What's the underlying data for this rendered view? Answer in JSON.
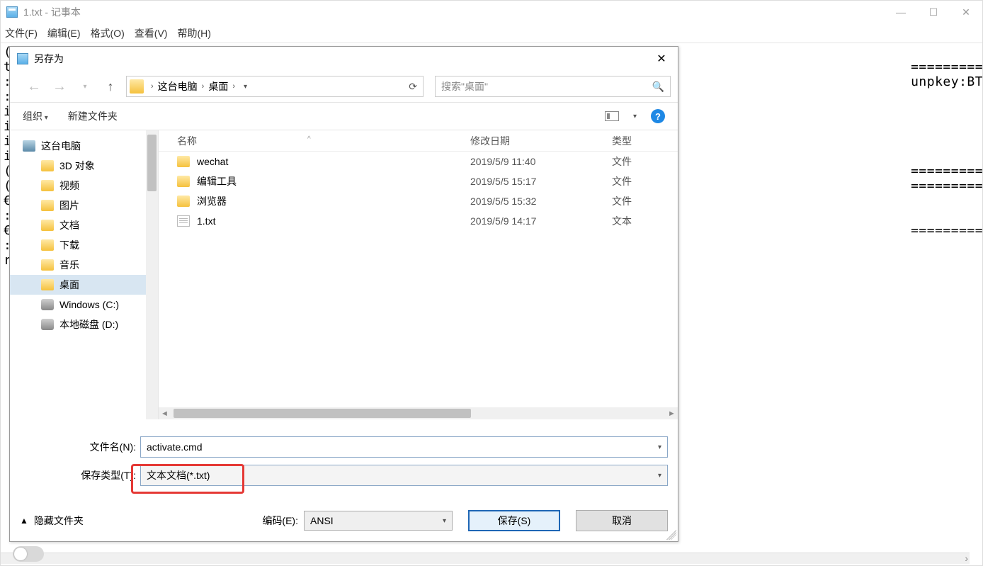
{
  "notepad": {
    "title": "1.txt - 记事本",
    "menu": {
      "file": "文件(F)",
      "edit": "编辑(E)",
      "format": "格式(O)",
      "view": "查看(V)",
      "help": "帮助(H)"
    },
    "body_lines": [
      "(",
      "t                                                                                                                =======================================",
      ":                                                                                                                unpkey:BTDRB >nul&cscript //nologo",
      ":",
      "i",
      "i",
      "i",
      "i",
      "(                                                                                                                =======================================",
      "(                                                                                                                =======================================",
      "€",
      ":",
      "€                                                                                                                =======================================",
      ":",
      "r"
    ]
  },
  "dialog": {
    "title": "另存为",
    "breadcrumb": {
      "seg1": "这台电脑",
      "seg2": "桌面"
    },
    "search_placeholder": "搜索\"桌面\"",
    "toolbar": {
      "organize": "组织",
      "newfolder": "新建文件夹"
    },
    "tree": {
      "root": "这台电脑",
      "items": [
        "3D 对象",
        "视频",
        "图片",
        "文档",
        "下载",
        "音乐",
        "桌面",
        "Windows (C:)",
        "本地磁盘 (D:)"
      ]
    },
    "columns": {
      "name": "名称",
      "date": "修改日期",
      "type": "类型"
    },
    "rows": [
      {
        "icon": "folder",
        "name": "wechat",
        "date": "2019/5/9 11:40",
        "type": "文件"
      },
      {
        "icon": "folder",
        "name": "编辑工具",
        "date": "2019/5/5 15:17",
        "type": "文件"
      },
      {
        "icon": "folder",
        "name": "浏览器",
        "date": "2019/5/5 15:32",
        "type": "文件"
      },
      {
        "icon": "txt",
        "name": "1.txt",
        "date": "2019/5/9 14:17",
        "type": "文本"
      }
    ],
    "filename_label": "文件名(N):",
    "filename_value": "activate.cmd",
    "filetype_label": "保存类型(T):",
    "filetype_value": "文本文档(*.txt)",
    "hide_folders": "隐藏文件夹",
    "encoding_label": "编码(E):",
    "encoding_value": "ANSI",
    "save": "保存(S)",
    "cancel": "取消"
  }
}
